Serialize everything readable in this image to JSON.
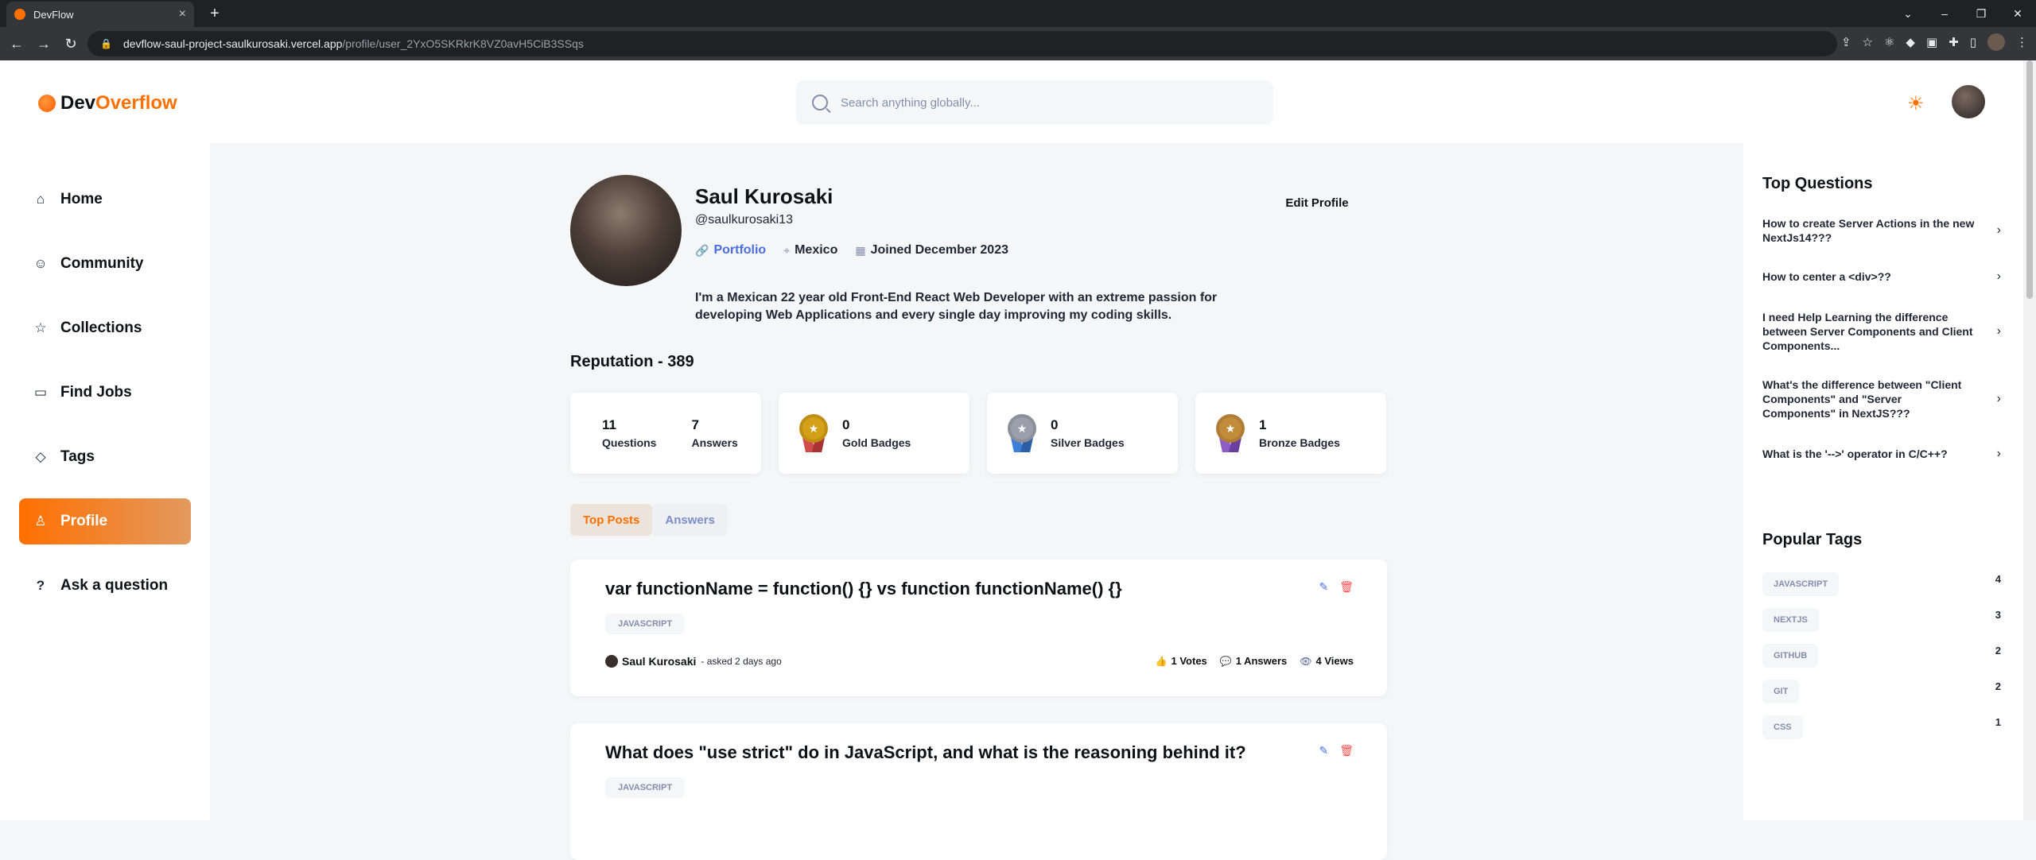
{
  "browser": {
    "tab_title": "DevFlow",
    "url_host": "devflow-saul-project-saulkurosaki.vercel.app",
    "url_path": "/profile/user_2YxO5SKRkrK8VZ0avH5CiB3SSqs"
  },
  "header": {
    "logo_prefix": "Dev",
    "logo_suffix": "Overflow",
    "search_placeholder": "Search anything globally..."
  },
  "sidebar": {
    "items": [
      {
        "label": "Home",
        "icon": "home-icon"
      },
      {
        "label": "Community",
        "icon": "users-icon"
      },
      {
        "label": "Collections",
        "icon": "star-icon"
      },
      {
        "label": "Find Jobs",
        "icon": "suitcase-icon"
      },
      {
        "label": "Tags",
        "icon": "tag-icon"
      },
      {
        "label": "Profile",
        "icon": "user-icon",
        "active": true
      },
      {
        "label": "Ask a question",
        "icon": "question-icon"
      }
    ]
  },
  "profile": {
    "name": "Saul Kurosaki",
    "username": "@saulkurosaki13",
    "portfolio_label": "Portfolio",
    "location": "Mexico",
    "joined": "Joined December 2023",
    "bio": "I'm a Mexican 22 year old Front-End React Web Developer with an extreme passion for developing Web Applications and every single day improving my coding skills.",
    "edit_label": "Edit Profile",
    "reputation": "Reputation - 389"
  },
  "stats": {
    "questions_count": "11",
    "questions_label": "Questions",
    "answers_count": "7",
    "answers_label": "Answers",
    "gold_count": "0",
    "gold_label": "Gold Badges",
    "silver_count": "0",
    "silver_label": "Silver Badges",
    "bronze_count": "1",
    "bronze_label": "Bronze Badges"
  },
  "tabs": {
    "top_posts": "Top Posts",
    "answers": "Answers"
  },
  "posts": [
    {
      "title": "var functionName = function() {} vs function functionName() {}",
      "tag": "JAVASCRIPT",
      "author": "Saul Kurosaki",
      "asked": "- asked 2 days ago",
      "votes": "1 Votes",
      "answers": "1 Answers",
      "views": "4 Views"
    },
    {
      "title": "What does \"use strict\" do in JavaScript, and what is the reasoning behind it?",
      "tag": "JAVASCRIPT"
    }
  ],
  "right": {
    "top_title": "Top Questions",
    "top_questions": [
      "How to create Server Actions in the new NextJs14???",
      "How to center a <div>??",
      "I need Help Learning the difference between Server Components and Client Components...",
      "What's the difference between \"Client Components\" and \"Server Components\" in NextJS???",
      "What is the '-->' operator in C/C++?"
    ],
    "tags_title": "Popular Tags",
    "tags": [
      {
        "name": "JAVASCRIPT",
        "count": "4"
      },
      {
        "name": "NEXTJS",
        "count": "3"
      },
      {
        "name": "GITHUB",
        "count": "2"
      },
      {
        "name": "GIT",
        "count": "2"
      },
      {
        "name": "CSS",
        "count": "1"
      }
    ]
  },
  "colors": {
    "brand": "#ff7000",
    "gold": "#d4a017",
    "silver": "#9aa0ab",
    "bronze": "#c28b3a"
  }
}
